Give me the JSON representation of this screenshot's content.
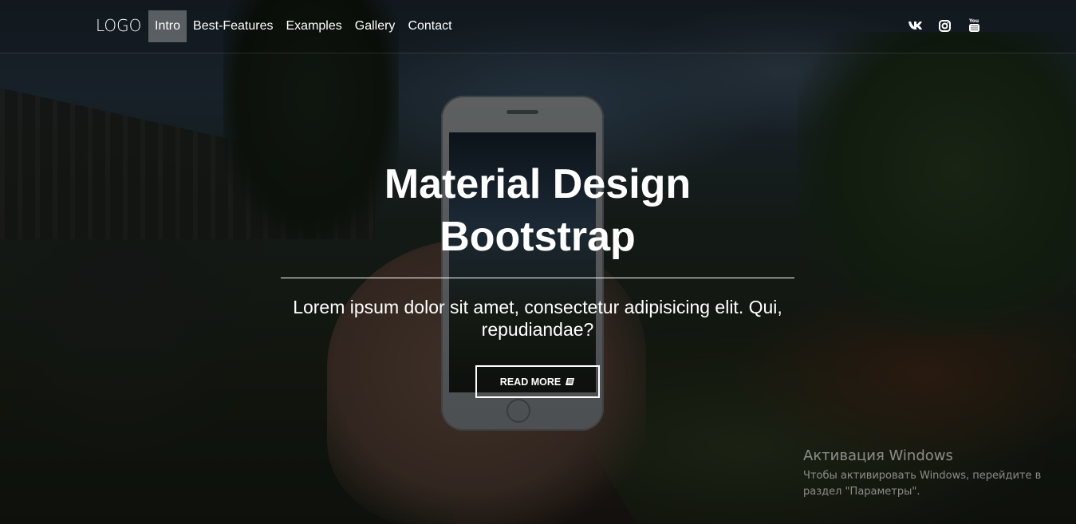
{
  "navbar": {
    "brand": "LOGO",
    "links": [
      {
        "label": "Intro",
        "active": true
      },
      {
        "label": "Best-Features",
        "active": false
      },
      {
        "label": "Examples",
        "active": false
      },
      {
        "label": "Gallery",
        "active": false
      },
      {
        "label": "Contact",
        "active": false
      }
    ],
    "social": [
      {
        "icon": "vk-icon"
      },
      {
        "icon": "instagram-icon"
      },
      {
        "icon": "youtube-icon"
      }
    ]
  },
  "hero": {
    "title_line1": "Material Design",
    "title_line2": "Bootstrap",
    "lead": "Lorem ipsum dolor sit amet, consectetur adipisicing elit. Qui, repudiandae?",
    "button_label": "READ MORE",
    "button_icon": "book-icon"
  },
  "windows_activation": {
    "title": "Активация Windows",
    "text": "Чтобы активировать Windows, перейдите в раздел \"Параметры\"."
  },
  "colors": {
    "overlay": "rgba(0,0,0,0.55)",
    "text": "#ffffff",
    "active_link_bg": "rgba(255,255,255,0.3)"
  }
}
